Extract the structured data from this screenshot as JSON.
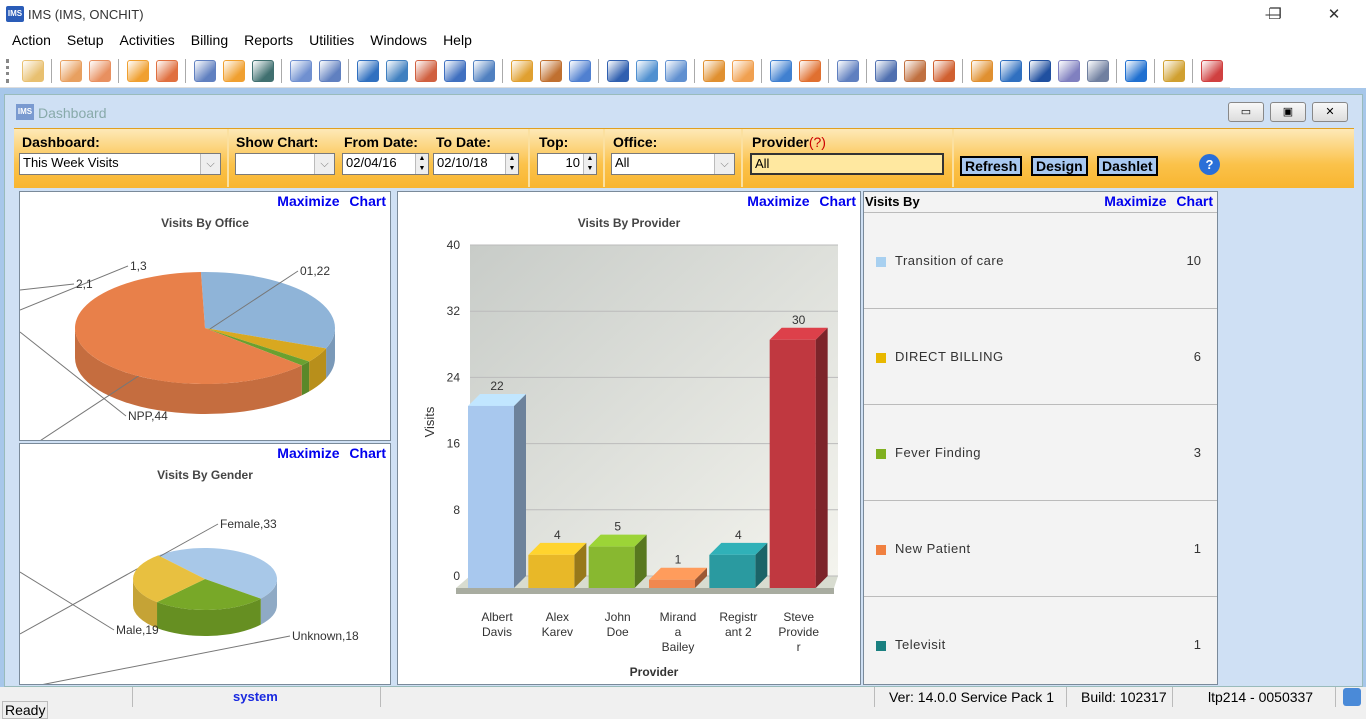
{
  "window": {
    "title": "IMS (IMS, ONCHIT)",
    "logo": "IMS",
    "minimize": "—",
    "restore": "❐",
    "close": "✕"
  },
  "menu": [
    "Action",
    "Setup",
    "Activities",
    "Billing",
    "Reports",
    "Utilities",
    "Windows",
    "Help"
  ],
  "toolbar": {
    "groups": [
      [
        {
          "icon": "patient-icon",
          "color": "#e8c070"
        }
      ],
      [
        {
          "icon": "patient-check-icon",
          "color": "#e8a060"
        },
        {
          "icon": "patient-check-red-icon",
          "color": "#e89060"
        }
      ],
      [
        {
          "icon": "folder-icon",
          "color": "#f0a030"
        },
        {
          "icon": "edit-person-icon",
          "color": "#e07040"
        }
      ],
      [
        {
          "icon": "prescription-icon",
          "color": "#6080c0"
        },
        {
          "icon": "flask-icon",
          "color": "#f0a030"
        },
        {
          "icon": "shield-icon",
          "color": "#407070"
        }
      ],
      [
        {
          "icon": "document-icon",
          "color": "#7090d0"
        },
        {
          "icon": "notes-icon",
          "color": "#6080c0"
        }
      ],
      [
        {
          "icon": "dollar-icon",
          "color": "#3070c0"
        },
        {
          "icon": "dollar-doc-icon",
          "color": "#4080c0"
        },
        {
          "icon": "dollar-person-icon",
          "color": "#d06040"
        },
        {
          "icon": "dollar-transfer-icon",
          "color": "#4070c0"
        },
        {
          "icon": "dollar-user-icon",
          "color": "#5080c0"
        }
      ],
      [
        {
          "icon": "calendar-grid-icon",
          "color": "#e0a030"
        },
        {
          "icon": "io-transfer-icon",
          "color": "#c07030"
        },
        {
          "icon": "form-check-icon",
          "color": "#5080d0"
        }
      ],
      [
        {
          "icon": "back-arrow-icon",
          "color": "#3060b0"
        },
        {
          "icon": "box-refresh-icon",
          "color": "#5090d0"
        },
        {
          "icon": "box-icon",
          "color": "#6090d0"
        }
      ],
      [
        {
          "icon": "grid-tools-icon",
          "color": "#e09030"
        },
        {
          "icon": "edit-doc-icon",
          "color": "#f0a050"
        }
      ],
      [
        {
          "icon": "bar-chart-icon",
          "color": "#4080d0"
        },
        {
          "icon": "person-chart-icon",
          "color": "#e07030"
        }
      ],
      [
        {
          "icon": "clipboard-icon",
          "color": "#6080c0"
        }
      ],
      [
        {
          "icon": "person-search-icon",
          "color": "#5070b0"
        },
        {
          "icon": "pen-icon",
          "color": "#c07040"
        },
        {
          "icon": "icd-icon",
          "color": "#d06030"
        }
      ],
      [
        {
          "icon": "redo-icon",
          "color": "#e09030"
        },
        {
          "icon": "sync-icon",
          "color": "#3070c0"
        },
        {
          "icon": "word-icon",
          "color": "#2050a0"
        },
        {
          "icon": "edit-page-icon",
          "color": "#8080c0"
        },
        {
          "icon": "report-icon",
          "color": "#7080a0"
        }
      ],
      [
        {
          "icon": "help-icon",
          "color": "#2070d0"
        }
      ],
      [
        {
          "icon": "lock-icon",
          "color": "#d0a030"
        }
      ],
      [
        {
          "icon": "exit-icon",
          "color": "#d04040"
        }
      ]
    ]
  },
  "dashboard_window": {
    "title": "Dashboard",
    "logo": "IMS",
    "minimize": "▭",
    "restore": "▣",
    "close": "✕"
  },
  "filters": {
    "dashboard_label": "Dashboard:",
    "dashboard_value": "This Week Visits",
    "show_chart_label": "Show Chart:",
    "show_chart_value": "",
    "from_date_label": "From Date:",
    "from_date_value": "02/04/16",
    "to_date_label": "To Date:",
    "to_date_value": "02/10/18",
    "top_label": "Top:",
    "top_value": "10",
    "office_label": "Office:",
    "office_value": "All",
    "provider_label": "Provider",
    "provider_hint": "(?)",
    "provider_value": "All",
    "refresh": "Refresh",
    "design": "Design",
    "dashlet": "Dashlet",
    "help": "?"
  },
  "maximize_link": "Maximize Chart",
  "chart_data": [
    {
      "type": "pie",
      "title": "Visits By Office",
      "labels": [
        "01",
        "1",
        "2",
        "NPP"
      ],
      "values": [
        22,
        3,
        1,
        44
      ],
      "colors": [
        "#8fb4d8",
        "#d8a820",
        "#6aa030",
        "#e8804a"
      ]
    },
    {
      "type": "pie",
      "title": "Visits By Gender",
      "labels": [
        "Female",
        "Unknown",
        "Male"
      ],
      "values": [
        33,
        18,
        19
      ],
      "colors": [
        "#a8c8e8",
        "#78a828",
        "#e8c040"
      ]
    },
    {
      "type": "bar",
      "title": "Visits By Provider",
      "xlabel": "Provider",
      "ylabel": "Visits",
      "ylim": [
        0,
        40
      ],
      "yticks": [
        0,
        8,
        16,
        24,
        32,
        40
      ],
      "categories": [
        "Albert Davis",
        "Alex Karev",
        "John Doe",
        "Miranda Bailey",
        "Registrant 2",
        "Steve Provider"
      ],
      "category_lines": [
        [
          "Albert",
          "Davis"
        ],
        [
          "Alex",
          "Karev"
        ],
        [
          "John",
          "Doe"
        ],
        [
          "Mirand",
          "a",
          "Bailey"
        ],
        [
          "Registr",
          "ant 2"
        ],
        [
          "Steve",
          "Provide",
          "r"
        ]
      ],
      "values": [
        22,
        4,
        5,
        1,
        4,
        30
      ],
      "colors": [
        "#a8c8ee",
        "#e8b828",
        "#88b830",
        "#f08850",
        "#2a9aa0",
        "#c03840"
      ]
    }
  ],
  "visits_by": {
    "title": "Visits By",
    "items": [
      {
        "name": "Transition of care",
        "value": "10",
        "color": "#a8d0f0"
      },
      {
        "name": "DIRECT BILLING",
        "value": "6",
        "color": "#e8b800"
      },
      {
        "name": "Fever Finding",
        "value": "3",
        "color": "#80b020"
      },
      {
        "name": "New Patient",
        "value": "1",
        "color": "#f08040"
      },
      {
        "name": "Televisit",
        "value": "1",
        "color": "#1a8080"
      }
    ]
  },
  "status": {
    "ready": "Ready",
    "user": "system",
    "version": "Ver: 14.0.0 Service Pack 1",
    "build": "Build: 102317",
    "machine": "ltp214 - 0050337"
  }
}
